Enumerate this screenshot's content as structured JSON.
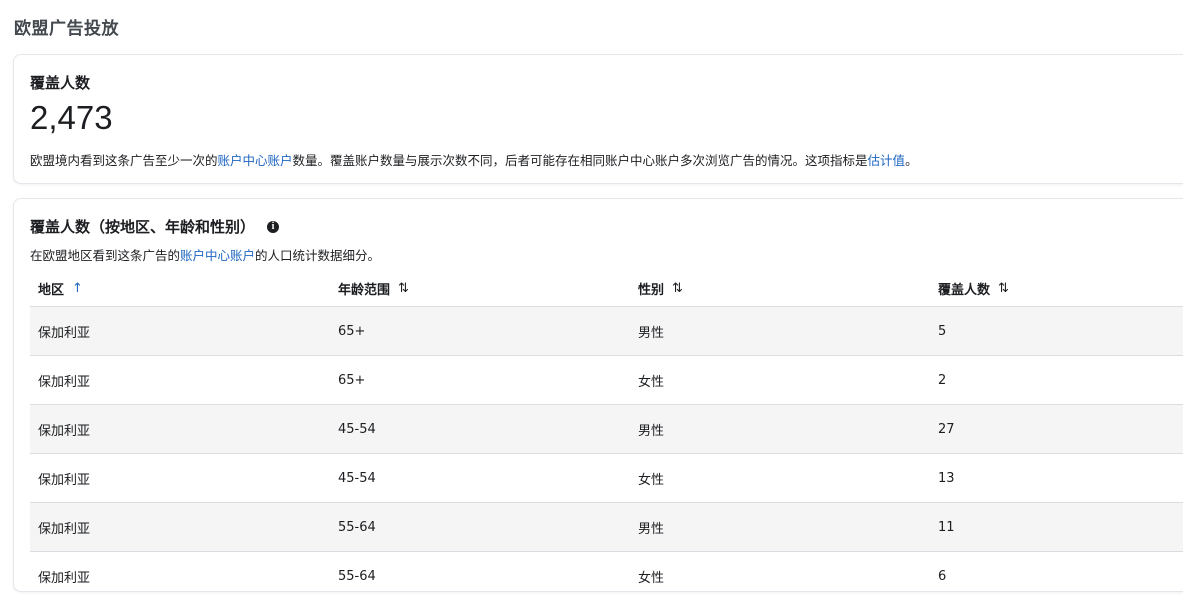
{
  "page": {
    "title": "欧盟广告投放"
  },
  "reach": {
    "title": "覆盖人数",
    "value": "2,473",
    "desc_part1": "欧盟境内看到这条广告至少一次的",
    "desc_link1": "账户中心账户",
    "desc_part2": "数量。覆盖账户数量与展示次数不同，后者可能存在相同账户中心账户多次浏览广告的情况。这项指标是",
    "desc_link2": "估计值",
    "desc_part3": "。"
  },
  "breakdown": {
    "title": "覆盖人数（按地区、年龄和性别）",
    "info_icon": "info-icon",
    "desc_part1": "在欧盟地区看到这条广告的",
    "desc_link": "账户中心账户",
    "desc_part2": "的人口统计数据细分。",
    "columns": [
      {
        "label": "地区",
        "sort": "↑",
        "sort_icon": "sort-ascending-icon"
      },
      {
        "label": "年龄范围",
        "sort": "⇅",
        "sort_icon": "sort-icon"
      },
      {
        "label": "性别",
        "sort": "⇅",
        "sort_icon": "sort-icon"
      },
      {
        "label": "覆盖人数",
        "sort": "⇅",
        "sort_icon": "sort-icon"
      }
    ],
    "rows": [
      [
        "保加利亚",
        "65+",
        "男性",
        "5"
      ],
      [
        "保加利亚",
        "65+",
        "女性",
        "2"
      ],
      [
        "保加利亚",
        "45-54",
        "男性",
        "27"
      ],
      [
        "保加利亚",
        "45-54",
        "女性",
        "13"
      ],
      [
        "保加利亚",
        "55-64",
        "男性",
        "11"
      ],
      [
        "保加利亚",
        "55-64",
        "女性",
        "6"
      ]
    ]
  },
  "colors": {
    "link": "#1d65c1",
    "stripe": "#f5f5f5",
    "border": "#dadde1"
  }
}
